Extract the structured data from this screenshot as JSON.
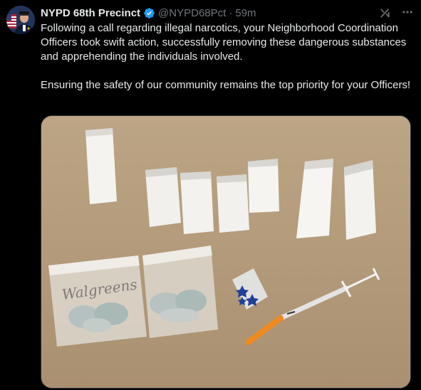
{
  "tweet": {
    "author_name": "NYPD 68th Precinct",
    "handle": "@NYPD68Pct",
    "separator": "·",
    "time": "59m",
    "paragraphs": [
      "Following a call regarding illegal narcotics, your Neighborhood Coordination Officers took swift action, successfully removing these dangerous substances and  apprehending the individuals involved.",
      "Ensuring the safety of our community remains the top priority for your Officers!"
    ]
  },
  "icons": {
    "verified": "verified-badge-icon",
    "grok": "grok-icon",
    "more": "more-options-icon"
  },
  "colors": {
    "background": "#000000",
    "text": "#e7e9ea",
    "secondary_text": "#71767b",
    "verified": "#1d9bf0",
    "media_border": "#2f3336"
  },
  "media": {
    "bag_brand_text": "Walgreens"
  }
}
